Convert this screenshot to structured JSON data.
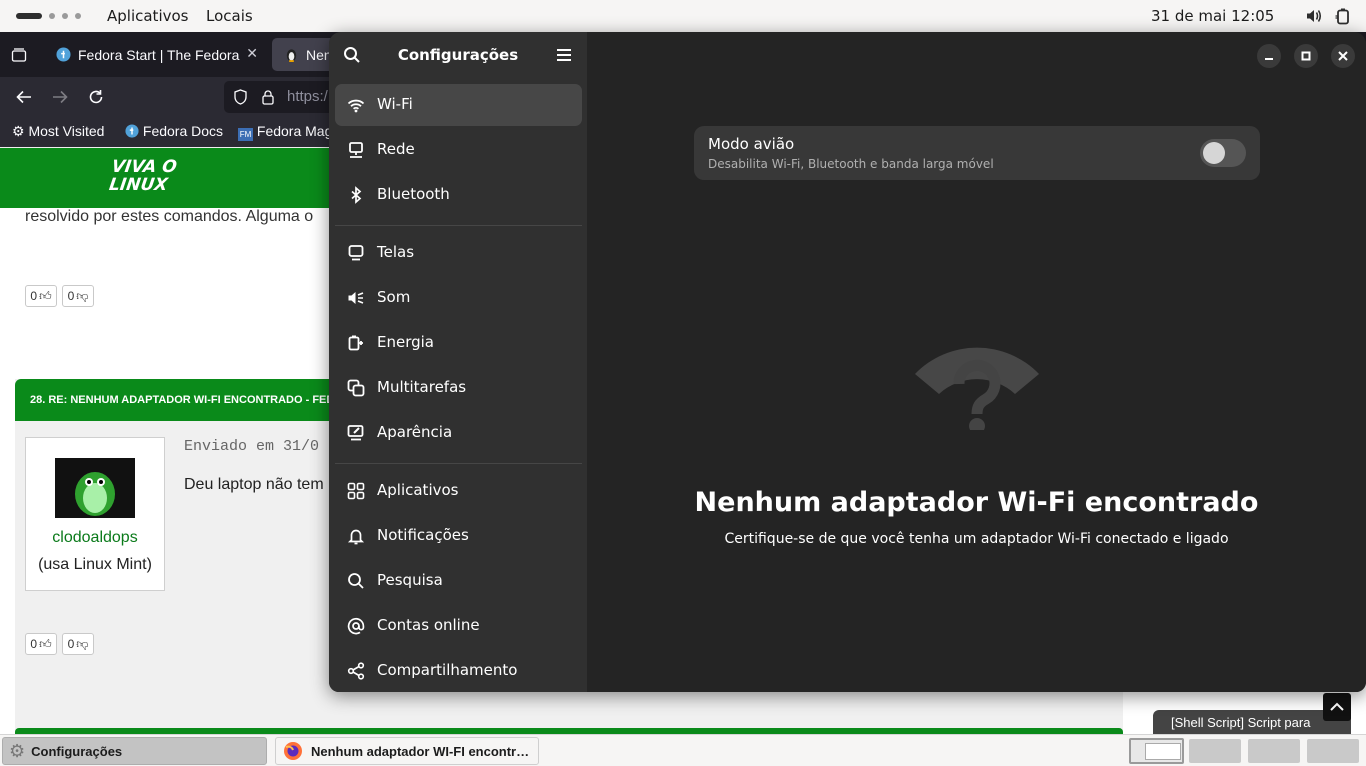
{
  "topbar": {
    "apps_menu": "Aplicativos",
    "places_menu": "Locais",
    "clock": "31 de mai  12:05"
  },
  "browser": {
    "tabs": [
      {
        "title": "Fedora Start | The Fedora"
      },
      {
        "title": "Nen"
      }
    ],
    "url_prefix": "https:/",
    "bookmarks": [
      {
        "label": "Most Visited"
      },
      {
        "label": "Fedora Docs"
      },
      {
        "label": "Fedora Mag"
      }
    ],
    "site_logo": "VIVA O LINUX",
    "page": {
      "text_line": "resolvido por estes comandos. Alguma o",
      "vote_up": "0",
      "vote_down": "0",
      "post_header": "28. RE: NENHUM ADAPTADOR WI-FI ENCONTRADO - FED",
      "sent_date": "Enviado em 31/0",
      "post_text": "Deu laptop não tem",
      "author_name": "clodoaldops",
      "author_distro": "(usa Linux Mint)",
      "side_link": "[Shell Script] Script para"
    }
  },
  "settings": {
    "title": "Configurações",
    "sidebar_items": [
      {
        "label": "Wi-Fi",
        "icon": "wifi-icon",
        "active": true
      },
      {
        "label": "Rede",
        "icon": "network-icon"
      },
      {
        "label": "Bluetooth",
        "icon": "bluetooth-icon"
      },
      {
        "label": "Telas",
        "icon": "display-icon"
      },
      {
        "label": "Som",
        "icon": "sound-icon"
      },
      {
        "label": "Energia",
        "icon": "power-icon"
      },
      {
        "label": "Multitarefas",
        "icon": "multitasking-icon"
      },
      {
        "label": "Aparência",
        "icon": "appearance-icon"
      },
      {
        "label": "Aplicativos",
        "icon": "apps-grid-icon"
      },
      {
        "label": "Notificações",
        "icon": "bell-icon"
      },
      {
        "label": "Pesquisa",
        "icon": "search-icon"
      },
      {
        "label": "Contas online",
        "icon": "at-sign-icon"
      },
      {
        "label": "Compartilhamento",
        "icon": "share-icon"
      }
    ],
    "airplane": {
      "title": "Modo avião",
      "subtitle": "Desabilita Wi-Fi, Bluetooth e banda larga móvel",
      "enabled": false
    },
    "empty_state": {
      "title": "Nenhum adaptador Wi-Fi encontrado",
      "subtitle": "Certifique-se de que você tenha um adaptador Wi-Fi conectado e ligado"
    }
  },
  "taskbar": {
    "tasks": [
      {
        "label": "Configurações",
        "active": true
      },
      {
        "label": "Nenhum adaptador WI-FI encontr…",
        "active": false
      }
    ]
  },
  "colors": {
    "site_green": "#0a8a1a",
    "settings_bg": "#242424",
    "sidebar_bg": "#303030",
    "sidebar_active": "#474747"
  }
}
